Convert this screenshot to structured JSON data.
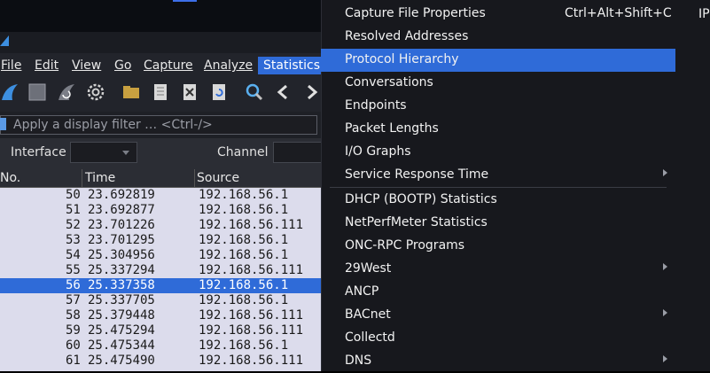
{
  "menubar": {
    "file": "File",
    "edit": "Edit",
    "view": "View",
    "go": "Go",
    "capture": "Capture",
    "analyze": "Analyze",
    "statistics": "Statistics"
  },
  "toolbar_icons": [
    "shark-fin-icon",
    "stop-icon",
    "restart-icon",
    "options-gear-icon",
    "open-folder-icon",
    "save-file-icon",
    "close-file-icon",
    "reload-icon",
    "find-icon",
    "back-arrow-icon",
    "forward-arrow-icon"
  ],
  "filter": {
    "placeholder": "Apply a display filter … <Ctrl-/>"
  },
  "interface_row": {
    "interface_label": "Interface",
    "channel_label": "Channel"
  },
  "packet_list": {
    "columns": [
      "No.",
      "Time",
      "Source"
    ],
    "rows": [
      {
        "no": "50",
        "time": "23.692819",
        "source": "192.168.56.1"
      },
      {
        "no": "51",
        "time": "23.692877",
        "source": "192.168.56.1"
      },
      {
        "no": "52",
        "time": "23.701226",
        "source": "192.168.56.111"
      },
      {
        "no": "53",
        "time": "23.701295",
        "source": "192.168.56.1"
      },
      {
        "no": "54",
        "time": "25.304956",
        "source": "192.168.56.1"
      },
      {
        "no": "55",
        "time": "25.337294",
        "source": "192.168.56.111"
      },
      {
        "no": "56",
        "time": "25.337358",
        "source": "192.168.56.1"
      },
      {
        "no": "57",
        "time": "25.337705",
        "source": "192.168.56.1"
      },
      {
        "no": "58",
        "time": "25.379448",
        "source": "192.168.56.111"
      },
      {
        "no": "59",
        "time": "25.475294",
        "source": "192.168.56.111"
      },
      {
        "no": "60",
        "time": "25.475344",
        "source": "192.168.56.1"
      },
      {
        "no": "61",
        "time": "25.475490",
        "source": "192.168.56.111"
      }
    ],
    "selected_no": "56"
  },
  "statistics_menu": {
    "items": [
      {
        "label": "Capture File Properties",
        "shortcut": "Ctrl+Alt+Shift+C"
      },
      {
        "label": "Resolved Addresses"
      },
      {
        "label": "Protocol Hierarchy",
        "highlighted": true
      },
      {
        "label": "Conversations"
      },
      {
        "label": "Endpoints"
      },
      {
        "label": "Packet Lengths"
      },
      {
        "label": "I/O Graphs"
      },
      {
        "label": "Service Response Time",
        "submenu": true
      },
      {
        "label": "DHCP (BOOTP) Statistics"
      },
      {
        "label": "NetPerfMeter Statistics"
      },
      {
        "label": "ONC-RPC Programs"
      },
      {
        "label": "29West",
        "submenu": true
      },
      {
        "label": "ANCP"
      },
      {
        "label": "BACnet",
        "submenu": true
      },
      {
        "label": "Collectd"
      },
      {
        "label": "DNS",
        "submenu": true
      }
    ]
  },
  "right_edge_text": "IP",
  "colors": {
    "accent": "#2f6bd8",
    "menu_bg": "#17181d",
    "list_bg": "#dcdcec"
  }
}
